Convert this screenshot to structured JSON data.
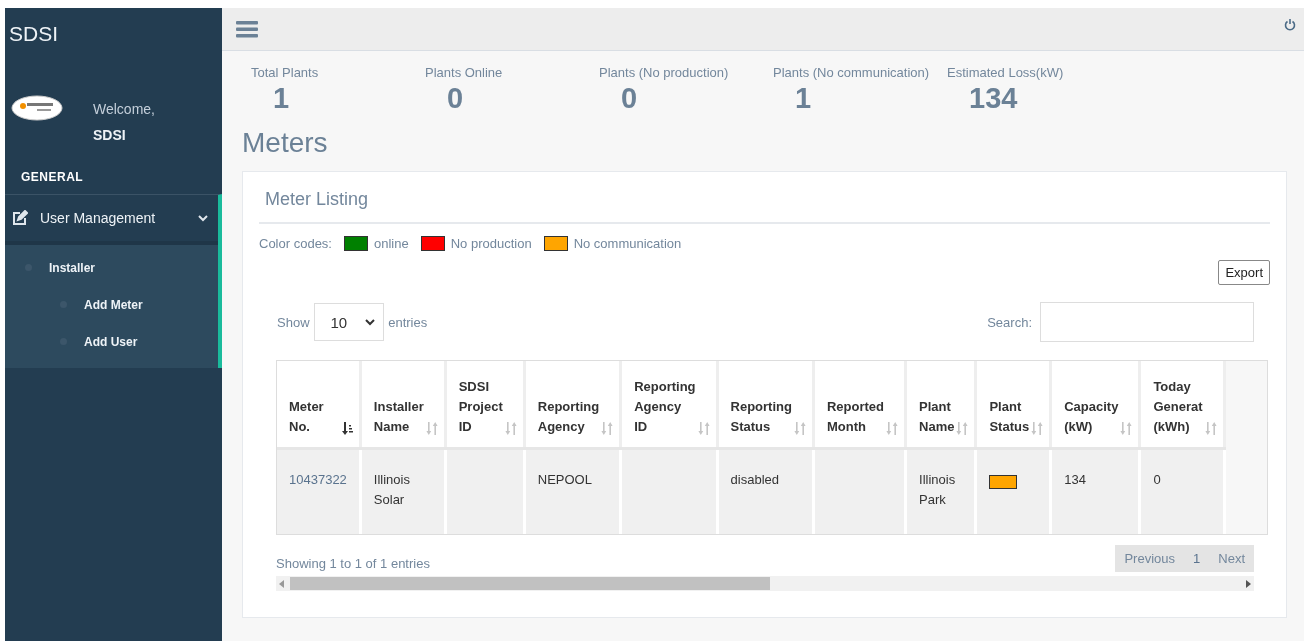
{
  "sidebar": {
    "brand": "SDSI",
    "welcome": "Welcome,",
    "user": "SDSI",
    "section": "GENERAL",
    "menu": [
      {
        "label": "User Management",
        "expanded": true,
        "children": [
          {
            "label": "Installer",
            "children": [
              {
                "label": "Add Meter"
              },
              {
                "label": "Add User"
              }
            ]
          }
        ]
      }
    ]
  },
  "stats": [
    {
      "label": "Total Plants",
      "value": "1"
    },
    {
      "label": "Plants Online",
      "value": "0"
    },
    {
      "label": "Plants (No production)",
      "value": "0"
    },
    {
      "label": "Plants (No communication)",
      "value": "1"
    },
    {
      "label": "Estimated Loss(kW)",
      "value": "134"
    }
  ],
  "page_title": "Meters",
  "card": {
    "title": "Meter Listing",
    "legend_label": "Color codes:",
    "legend": [
      {
        "label": "online",
        "color": "#008000"
      },
      {
        "label": "No production",
        "color": "#ff0000"
      },
      {
        "label": "No communication",
        "color": "#ffa500"
      }
    ],
    "export_button": "Export",
    "show_label": "Show",
    "page_size": "10",
    "entries_label": "entries",
    "search_label": "Search:",
    "table": {
      "columns": [
        {
          "label": "Meter\nNo.",
          "sorted": true
        },
        {
          "label": "Installer\nName",
          "sorted": false
        },
        {
          "label": "SDSI\nProject\nID",
          "sorted": false
        },
        {
          "label": "Reporting\nAgency",
          "sorted": false
        },
        {
          "label": "Reporting\nAgency\nID",
          "sorted": false
        },
        {
          "label": "Reporting\nStatus",
          "sorted": false
        },
        {
          "label": "Reported\nMonth",
          "sorted": false
        },
        {
          "label": "Plant\nName",
          "sorted": false
        },
        {
          "label": "Plant\nStatus",
          "sorted": false
        },
        {
          "label": "Capacity\n(kW)",
          "sorted": false
        },
        {
          "label": "Today\nGenerat\n(kWh)",
          "sorted": false
        }
      ],
      "rows": [
        {
          "cells": [
            {
              "kind": "link",
              "text": "10437322"
            },
            {
              "kind": "text",
              "text": "Illinois\nSolar"
            },
            {
              "kind": "empty"
            },
            {
              "kind": "text",
              "text": "NEPOOL"
            },
            {
              "kind": "empty"
            },
            {
              "kind": "text",
              "text": "disabled"
            },
            {
              "kind": "empty"
            },
            {
              "kind": "text",
              "text": "Illinois\nPark"
            },
            {
              "kind": "status",
              "color": "#ffa500"
            },
            {
              "kind": "text",
              "text": "134"
            },
            {
              "kind": "text",
              "text": "0"
            }
          ]
        }
      ]
    },
    "info": "Showing 1 to 1 of 1 entries",
    "pagination": [
      {
        "label": "Previous",
        "selected": false
      },
      {
        "label": "1",
        "selected": true
      },
      {
        "label": "Next",
        "selected": false
      }
    ]
  }
}
